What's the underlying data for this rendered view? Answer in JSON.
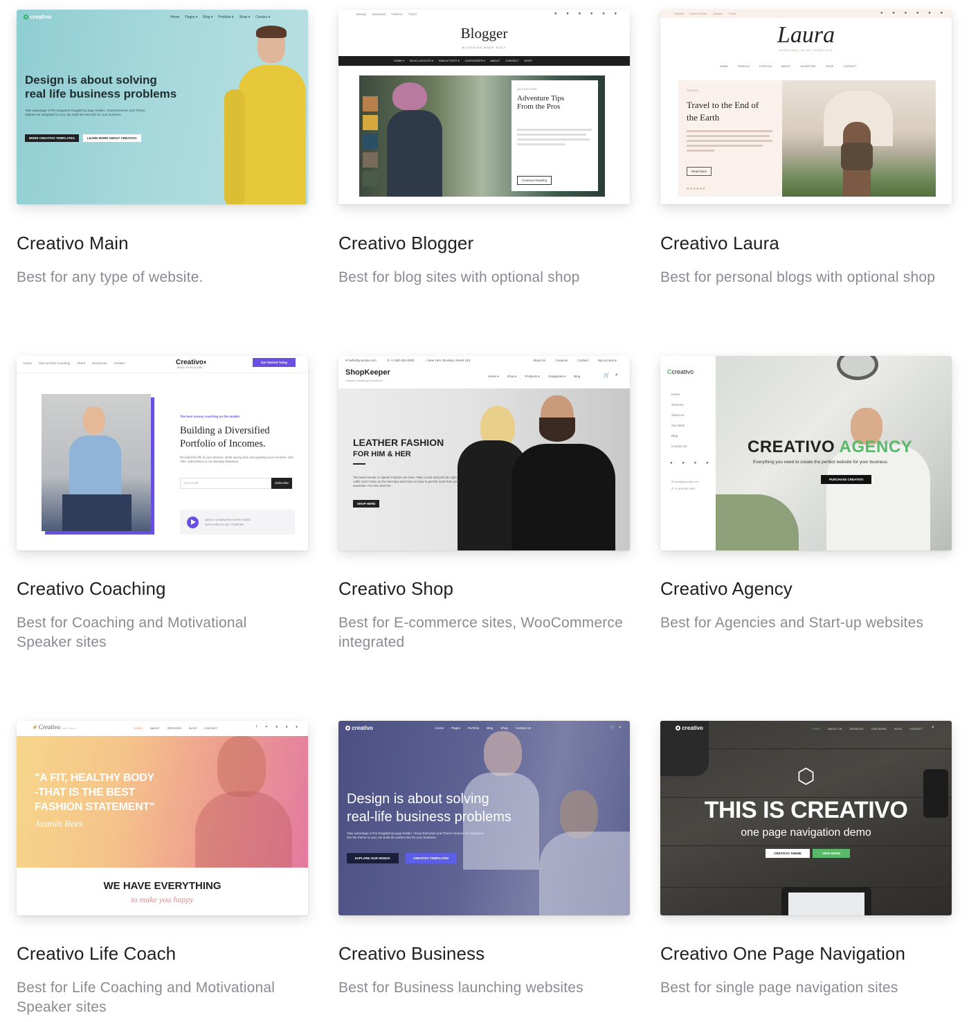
{
  "cards": [
    {
      "title": "Creativo Main",
      "desc": "Best for any type of website.",
      "preview": {
        "logo": "creativo",
        "nav": [
          "Home",
          "Pages ▾",
          "Blog ▾",
          "Portfolio ▾",
          "Shop ▾",
          "Contact ▾"
        ],
        "headline_1": "Design is about solving",
        "headline_2": "real life business problems",
        "body": "Take advantage of the integrated Drag&Drop page builder, Visual Elements and Theme Options we integrated so you can build the best site for your business.",
        "btn_primary": "MORE CREATIVO TEMPLATES",
        "btn_secondary": "LEARN MORE ABOUT CREATIVO"
      }
    },
    {
      "title": "Creativo Blogger",
      "desc": "Best for blog sites with optional shop",
      "preview": {
        "topnav": [
          "Beauty",
          "Adventure",
          "Fashion",
          "Travel"
        ],
        "logo": "Blogger",
        "tagline": "BLOGGING MADE EASY",
        "nav": [
          "HOME ▾",
          "BLOG LAYOUTS ▾",
          "SINGLE POST ▾",
          "CATEGORIES ▾",
          "ABOUT",
          "CONTACT",
          "SHOP"
        ],
        "category": "ADVENTURE",
        "post_title_1": "Adventure Tips",
        "post_title_2": "From the Pros",
        "button": "Continue Reading"
      }
    },
    {
      "title": "Creativo Laura",
      "desc": "Best for personal blogs with optional shop",
      "preview": {
        "topnav": [
          "Fashion",
          "Food & Drinks",
          "Lifestyle",
          "Travel"
        ],
        "logo": "Laura",
        "tagline": "PERSONAL BLOG TEMPLATE",
        "nav": [
          "HOME",
          "PAGES ▾",
          "TOPICS ▾",
          "ABOUT",
          "ADVERTISE",
          "SHOP",
          "CONTACT"
        ],
        "category": "TRAVEL",
        "post_title_1": "Travel to the End of",
        "post_title_2": "the Earth",
        "button": "Read More"
      }
    },
    {
      "title": "Creativo Coaching",
      "desc": "Best for Coaching and Motivational Speaker sites",
      "preview": {
        "nav": [
          "Home",
          "One-on-One Coaching",
          "About",
          "Resources",
          "Contact"
        ],
        "logo": "Creativo",
        "logo_sub": "BUILD YOUR FUTURE",
        "cta": "Get Started Today",
        "eyebrow": "The best money coaching on the market",
        "headline_1": "Building a Diversified",
        "headline_2": "Portfolio of Incomes.",
        "body": "Re-build the life of your dreams, while saving time and growing your incomes. Join 75k+ subscribers to our Monday Webinars",
        "email_placeholder": "Your email",
        "subscribe": "Subscribe",
        "video_1": "WATCH 15 MINUTES INTRO VIDEO",
        "video_2": "WITH HOW TO GET STARTED"
      }
    },
    {
      "title": "Creativo Shop",
      "desc": "Best for E-commerce sites, WooCommerce integrated",
      "preview": {
        "email": "hello@yoursite.com",
        "phone": "+1 800-252-0000",
        "address": "New York, Brooklyn Street 129",
        "toplinks": [
          "About Us",
          "Coupons",
          "Contact",
          "My Account ▾"
        ],
        "logo": "ShopKeeper",
        "logo_sub": "Ultimate Shopping Experience",
        "nav": [
          "Home ▾",
          "Shop ▾",
          "Products ▾",
          "Categories ▾",
          "Blog"
        ],
        "headline_1": "LEATHER FASHION",
        "headline_2": "FOR HIM & HER",
        "body": "The latest trends in Hipster Fashion are here. Take a look and pick the right outfit. Don't miss out the best tips and tricks on how to get the most from your wardrobe. For Him and Her.",
        "button": "SHOP HERE"
      }
    },
    {
      "title": "Creativo Agency",
      "desc": "Best for Agencies and Start-up websites",
      "preview": {
        "logo": "creativo",
        "nav": [
          "Home",
          "Services",
          "About Us",
          "Our Work",
          "Blog",
          "Contact Us"
        ],
        "email": "hello@yoursite.com",
        "phone": "+1 800 452 0000",
        "headline_a": "CREATIVO",
        "headline_b": "AGENCY",
        "sub": "Everything you need to create the perfect website for your business",
        "button": "PURCHASE CREATIVO"
      }
    },
    {
      "title": "Creativo Life Coach",
      "desc": "Best for Life Coaching and Motivational Speaker sites",
      "preview": {
        "logo": "Creativo",
        "logo_sub": "LIFE COACH",
        "nav": [
          "HOME",
          "ABOUT",
          "SERVICES",
          "BLOG",
          "CONTACT"
        ],
        "quote_1": "\"A FIT, HEALTHY BODY",
        "quote_2": "-THAT IS THE BEST",
        "quote_3": "FASHION STATEMENT\"",
        "author": "Jasmin Rees",
        "band_1": "WE HAVE EVERYTHING",
        "band_2": "to make you happy"
      }
    },
    {
      "title": "Creativo Business",
      "desc": "Best for Business launching websites",
      "preview": {
        "logo": "creativo",
        "nav": [
          "Home",
          "Pages",
          "Portfolio",
          "Blog",
          "Shop",
          "Contact Us"
        ],
        "headline_1": "Design is about solving",
        "headline_2": "real-life business problems",
        "body": "Take advantage of the Drag&Drop page builder, Visual Elements and Theme Options we integrated into the theme so you can build the perfect site for your business",
        "btn_primary": "EXPLORE OUR DEMOS",
        "btn_secondary": "CREATIVO TEMPLATES"
      }
    },
    {
      "title": "Creativo One Page Navigation",
      "desc": "Best for single page navigation sites",
      "preview": {
        "logo": "creativo",
        "nav": [
          "HOME",
          "ABOUT US",
          "SERVICES",
          "OUR WORK",
          "BLOG",
          "CONTACT"
        ],
        "headline": "THIS IS CREATIVO",
        "sub": "one page navigation demo",
        "btn_primary": "CREATIVO THEME",
        "btn_secondary": "VIEW MORE"
      }
    }
  ],
  "colors": {
    "title": "#1f1f23",
    "desc": "#8a8a92",
    "main_bg": "#9ed2d6",
    "coaching_accent": "#6a4fe3",
    "agency_accent": "#59b86a",
    "business_overlay": "#4a4f86"
  }
}
